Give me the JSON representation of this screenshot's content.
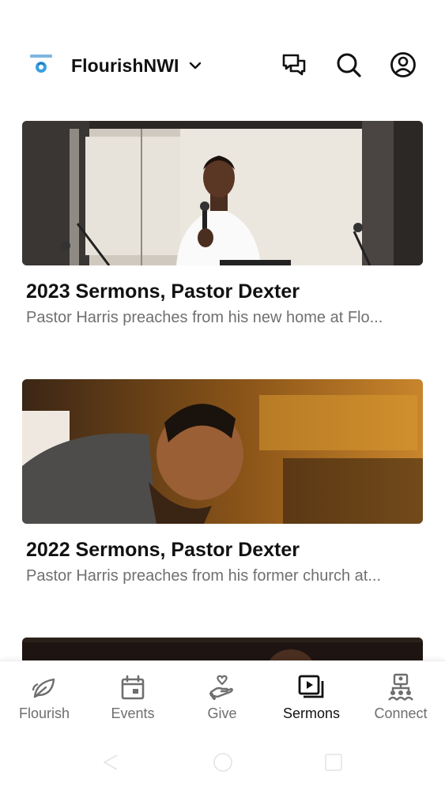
{
  "header": {
    "org_name": "FlourishNWI",
    "icons": [
      "messages-icon",
      "search-icon",
      "profile-icon"
    ]
  },
  "sermons": [
    {
      "title": "2023 Sermons, Pastor Dexter",
      "subtitle": "Pastor Harris preaches from his new home at Flo..."
    },
    {
      "title": "2022 Sermons, Pastor Dexter",
      "subtitle": "Pastor Harris preaches from his former church at..."
    }
  ],
  "tabs": [
    {
      "label": "Flourish",
      "icon": "leaf-icon"
    },
    {
      "label": "Events",
      "icon": "calendar-icon"
    },
    {
      "label": "Give",
      "icon": "give-hand-icon"
    },
    {
      "label": "Sermons",
      "icon": "video-player-icon",
      "active": true
    },
    {
      "label": "Connect",
      "icon": "people-network-icon"
    }
  ],
  "colors": {
    "text_primary": "#111111",
    "text_secondary": "#707070",
    "tab_inactive": "#6e6e6e",
    "background": "#ffffff"
  }
}
